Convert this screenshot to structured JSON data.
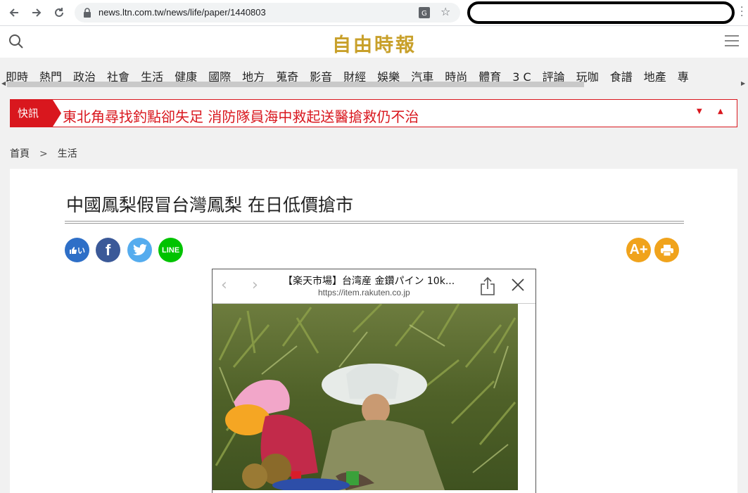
{
  "browser": {
    "url": "news.ltn.com.tw/news/life/paper/1440803"
  },
  "site": {
    "logo": "自由時報"
  },
  "categories": [
    "即時",
    "熱門",
    "政治",
    "社會",
    "生活",
    "健康",
    "國際",
    "地方",
    "蒐奇",
    "影音",
    "財經",
    "娛樂",
    "汽車",
    "時尚",
    "體育",
    "3 C",
    "評論",
    "玩咖",
    "食譜",
    "地產",
    "專"
  ],
  "breaking": {
    "tag": "快訊",
    "headline": "東北角尋找釣點卻失足 消防隊員海中救起送醫搶救仍不治"
  },
  "breadcrumb": {
    "home": "首頁",
    "separator": ">",
    "section": "生活"
  },
  "article": {
    "title": "中國鳳梨假冒台灣鳳梨 在日低價搶市"
  },
  "social": {
    "like_label": "い",
    "line_label": "LINE",
    "font_label": "A+"
  },
  "viewer": {
    "title": "【楽天市場】台湾産 金鑽パイン 10k...",
    "url": "https://item.rakuten.co.jp"
  },
  "colors": {
    "brand_red": "#d9171e",
    "logo_gold": "#c8a02a",
    "facebook": "#3b5998",
    "twitter": "#55acee",
    "line": "#00c300",
    "tool_orange": "#f0a31c"
  }
}
